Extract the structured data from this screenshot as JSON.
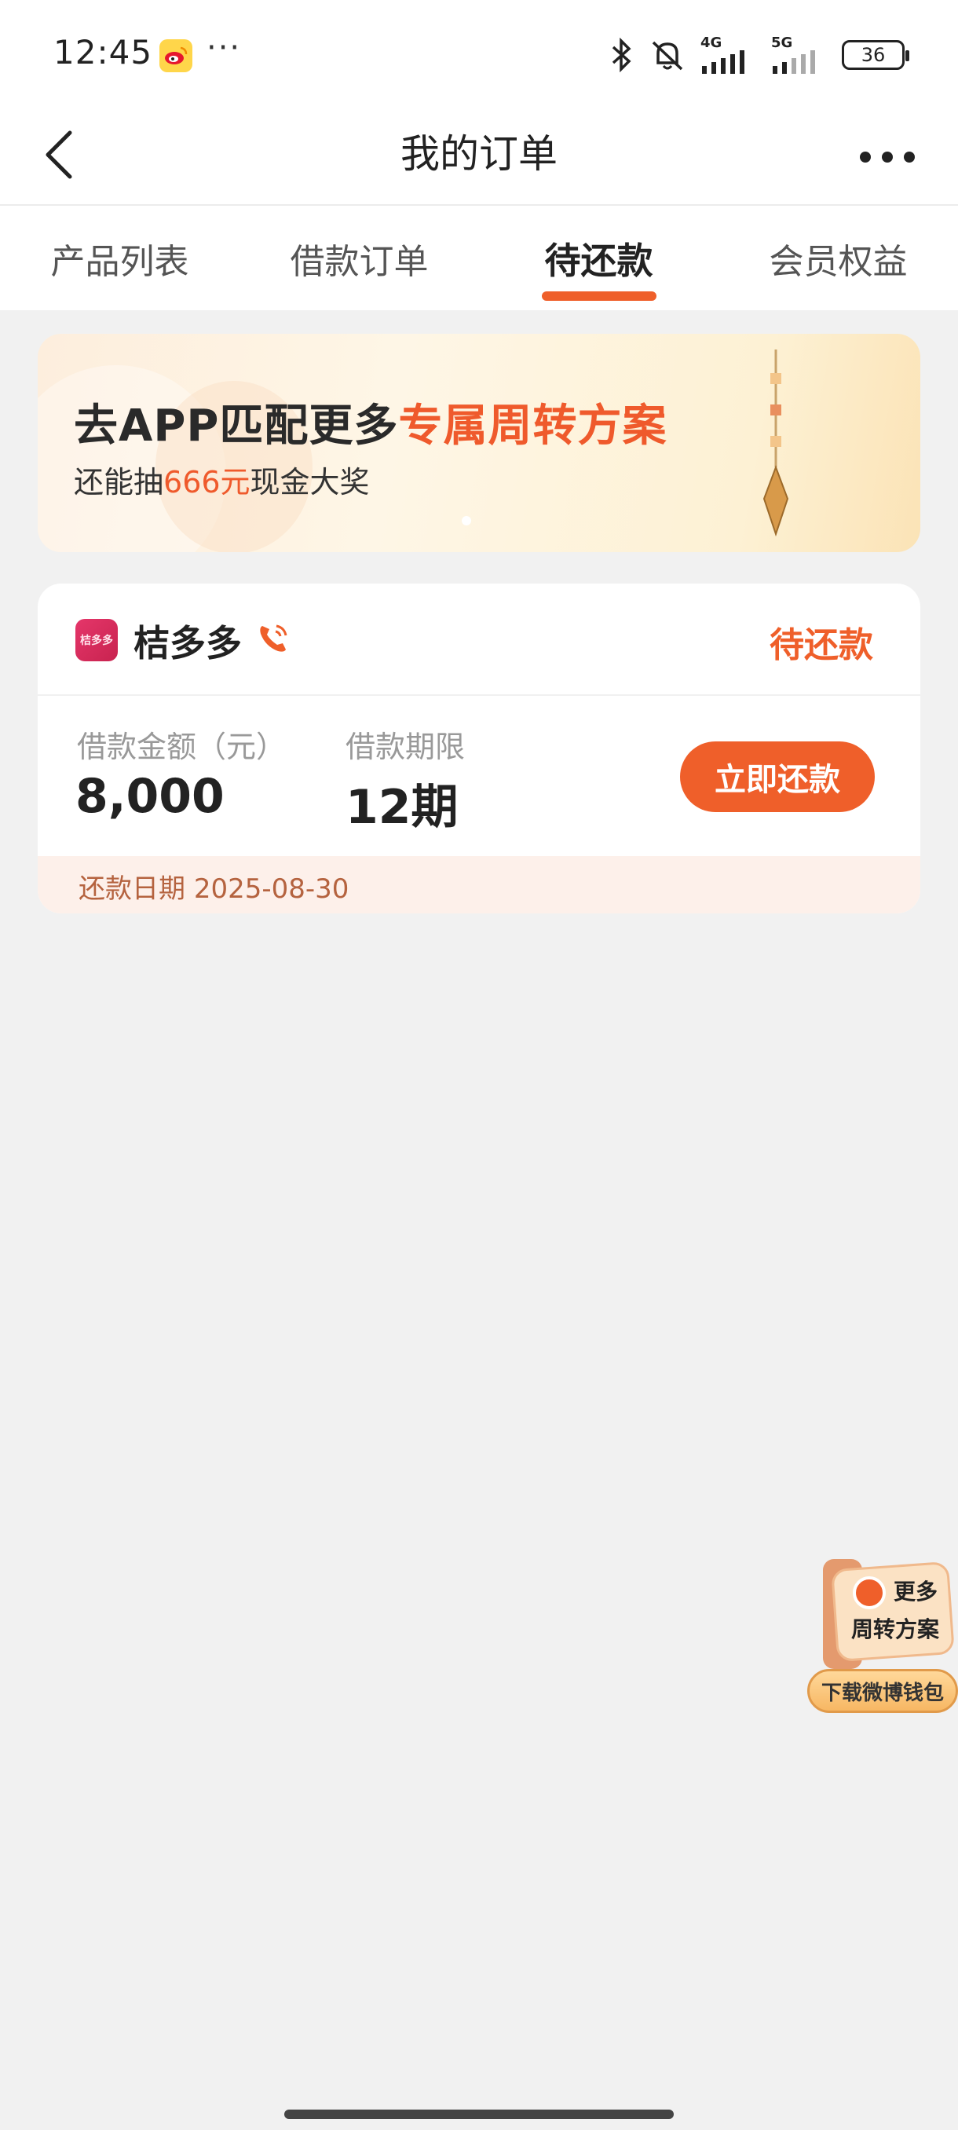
{
  "status_bar": {
    "time": "12:45",
    "more": "···",
    "network_1": "4G",
    "network_2": "5G",
    "battery": "36",
    "icons": [
      "weibo-icon",
      "bluetooth-icon",
      "bell-muted-icon",
      "signal-icon",
      "battery-icon"
    ]
  },
  "header": {
    "title": "我的订单"
  },
  "tabs": [
    {
      "label": "产品列表",
      "active": false
    },
    {
      "label": "借款订单",
      "active": false
    },
    {
      "label": "待还款",
      "active": true
    },
    {
      "label": "会员权益",
      "active": false
    }
  ],
  "banner": {
    "title_prefix": "去APP匹配更多",
    "title_highlight": "专属周转方案",
    "sub_prefix": "还能抽",
    "sub_highlight": "666元",
    "sub_suffix": "现金大奖"
  },
  "order": {
    "logo_text": "桔多多",
    "product_name": "桔多多",
    "status": "待还款",
    "amount_label": "借款金额（元）",
    "amount_value": "8,000",
    "term_label": "借款期限",
    "term_value": "12期",
    "pay_button": "立即还款",
    "due_label": "还款日期",
    "due_date": "2025-08-30"
  },
  "float_widget": {
    "line1": "更多",
    "line2": "周转方案",
    "button": "下载微博钱包"
  },
  "colors": {
    "accent": "#ef5f2a",
    "background": "#f1f1f1",
    "card": "#ffffff",
    "due_bg": "#fdf0ea"
  }
}
